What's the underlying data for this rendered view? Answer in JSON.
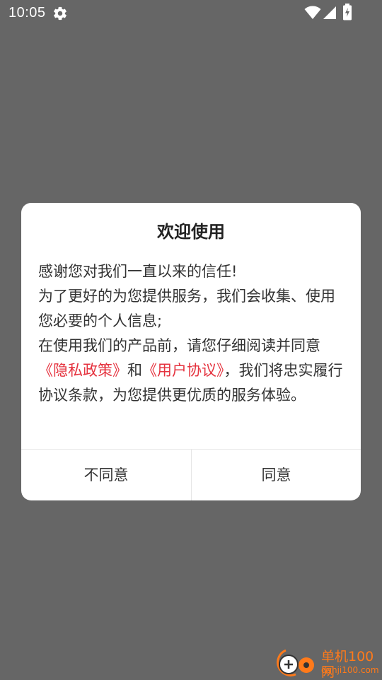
{
  "status_bar": {
    "time": "10:05",
    "icons": [
      "gear-icon",
      "wifi-icon",
      "signal-icon",
      "battery-icon"
    ]
  },
  "dialog": {
    "title": "欢迎使用",
    "body": {
      "line1": "感谢您对我们一直以来的信任!",
      "line2": "为了更好的为您提供服务，我们会收集、使用您必要的个人信息;",
      "line3_prefix": "在使用我们的产品前，请您仔细阅读并同意",
      "privacy_link": "《隐私政策》",
      "connector": "和",
      "agreement_link": "《用户协议》",
      "line3_suffix": "，我们将忠实履行协议条款，为您提供更优质的服务体验。"
    },
    "buttons": {
      "disagree": "不同意",
      "agree": "同意"
    }
  },
  "watermark": {
    "title": "单机100网",
    "url": "danji100.com"
  },
  "colors": {
    "overlay_background": "#666666",
    "dialog_background": "#ffffff",
    "link": "#e5333f",
    "watermark": "#ff7a1a"
  }
}
